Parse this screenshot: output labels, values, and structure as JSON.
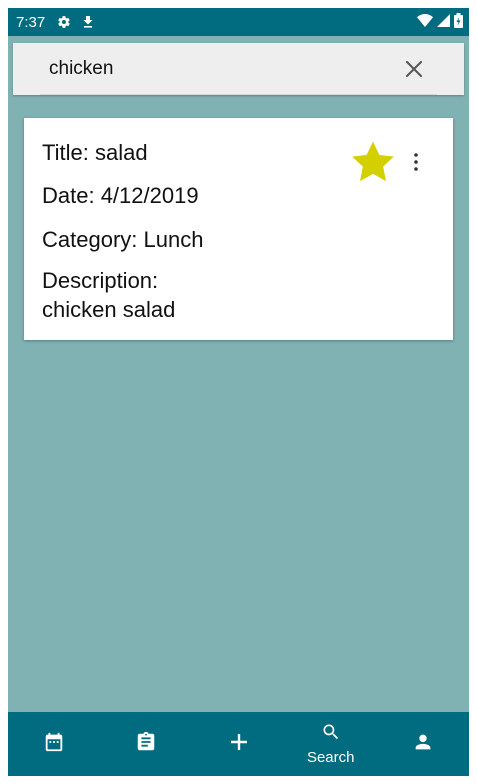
{
  "status_bar": {
    "time": "7:37"
  },
  "search": {
    "query": "chicken"
  },
  "results": [
    {
      "title": "Title: salad",
      "date": "Date: 4/12/2019",
      "category": "Category: Lunch",
      "description_label": "Description:",
      "description": "chicken salad",
      "starred": true
    }
  ],
  "bottom_nav": {
    "items": [
      {
        "icon": "calendar-icon",
        "label": ""
      },
      {
        "icon": "clipboard-icon",
        "label": ""
      },
      {
        "icon": "add-icon",
        "label": ""
      },
      {
        "icon": "search-icon",
        "label": "Search"
      },
      {
        "icon": "person-icon",
        "label": ""
      }
    ]
  },
  "colors": {
    "primary": "#016b80",
    "background": "#80b1b3",
    "star": "#d4d000",
    "card": "#ffffff",
    "search_bar": "#eeeeee"
  }
}
